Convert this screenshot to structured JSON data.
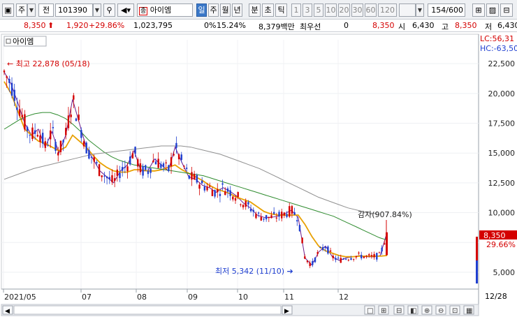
{
  "toolbar": {
    "market": "주",
    "cate": "전",
    "code": "101390",
    "name": "아이엠",
    "periods": [
      "일",
      "주",
      "월",
      "년",
      "분",
      "초",
      "틱"
    ],
    "intervals": [
      "1",
      "3",
      "5",
      "10",
      "20",
      "30",
      "60",
      "120"
    ],
    "count": "154",
    "count_total": "/600"
  },
  "quote": {
    "price": "8,350",
    "change": "1,920",
    "change_pct": "+29.86%",
    "volume": "1,023,795",
    "turnover": "0%",
    "ratio": "15.24%",
    "amount": "8,379백만",
    "best_label": "최우선",
    "best_value": "0",
    "ask": "8,350",
    "open_label": "시",
    "open": "6,430",
    "high_label": "고",
    "high": "8,350",
    "low_label": "저",
    "low": "6,430"
  },
  "chart": {
    "legend": "아이엠",
    "high_note": "최고 22,878 (05/18)",
    "low_note": "최저 5,342 (11/10)",
    "sense_note": "감자(907.84%)",
    "lc": "LC:56,31",
    "hc": "HC:-63,50",
    "price_tag": "8,350",
    "pct_tag": "29.66%",
    "end_date": "12/28",
    "x_ticks": [
      "2021/05",
      "07",
      "08",
      "09",
      "10",
      "11",
      "12"
    ],
    "y_ticks": [
      "22,500",
      "20,000",
      "17,500",
      "15,000",
      "12,500",
      "10,000",
      "5,000"
    ]
  },
  "chart_data": {
    "type": "candlestick",
    "title": "아이엠",
    "x": [
      "2021/05",
      "07",
      "08",
      "09",
      "10",
      "11",
      "12"
    ],
    "ylim": [
      4000,
      24500
    ],
    "series": [
      {
        "values": [
          21800,
          20800,
          19200,
          17500,
          16500,
          17000,
          15500,
          16800,
          15000,
          16500,
          19500,
          17500,
          15500,
          14500,
          13500,
          13000,
          12500,
          13500,
          14000,
          15200,
          13500,
          13500,
          14500,
          14000,
          13500,
          15500,
          14200,
          13000,
          12800,
          12300,
          12100,
          11700,
          12100,
          11800,
          11400,
          10800,
          10400,
          9800,
          9600,
          9600,
          9700,
          9900,
          10200,
          9600,
          6200,
          5600,
          6700,
          7200,
          6300,
          6000,
          6200,
          6300,
          6400,
          6300,
          6300,
          6400,
          8350
        ]
      },
      {
        "values": [
          21000,
          20000,
          18500,
          17000,
          16500,
          16000,
          15800,
          15500,
          15200,
          15500,
          16500,
          16000,
          15500,
          14800,
          14200,
          13800,
          13500,
          13400,
          13400,
          13600,
          13600,
          13500,
          13500,
          13600,
          13800,
          14000,
          13600,
          13300,
          13000,
          12700,
          12300,
          12000,
          11800,
          11600,
          11300,
          11100,
          10900,
          10500,
          10100,
          9900,
          9800,
          9800,
          9800,
          9800,
          9000,
          8000,
          7200,
          6800,
          6600,
          6400,
          6300,
          6300,
          6350,
          6350,
          6350,
          6350,
          6400
        ]
      },
      {
        "values": [
          17000,
          17400,
          17800,
          18100,
          18300,
          18400,
          18400,
          18200,
          17900,
          17400,
          16800,
          16100,
          15600,
          15100,
          14700,
          14400,
          14200,
          14000,
          13900,
          13800,
          13700,
          13600,
          13500,
          13400,
          13300,
          13200,
          13100,
          12900,
          12700,
          12500,
          12300,
          12100,
          11900,
          11700,
          11500,
          11300,
          11100,
          10900,
          10700,
          10500,
          10300,
          10100,
          9900,
          9700,
          9400,
          9100,
          8800,
          8500,
          8200,
          7900,
          7700
        ]
      },
      {
        "values": [
          12800,
          13100,
          13400,
          13700,
          13900,
          14100,
          14300,
          14500,
          14700,
          14900,
          15000,
          15100,
          15200,
          15300,
          15400,
          15500,
          15600,
          15600,
          15600,
          15500,
          15300,
          15100,
          14900,
          14600,
          14300,
          14000,
          13700,
          13300,
          12900,
          12500,
          12100,
          11700,
          11300,
          11000,
          10700,
          10400,
          10200,
          10000,
          9900
        ]
      }
    ]
  },
  "colors": {
    "ma5": "#6b1a8c",
    "ma20": "#e8a000",
    "ma60": "#2e8b2e",
    "ma120": "#909090",
    "up": "#d40000",
    "down": "#1f3fd0"
  }
}
